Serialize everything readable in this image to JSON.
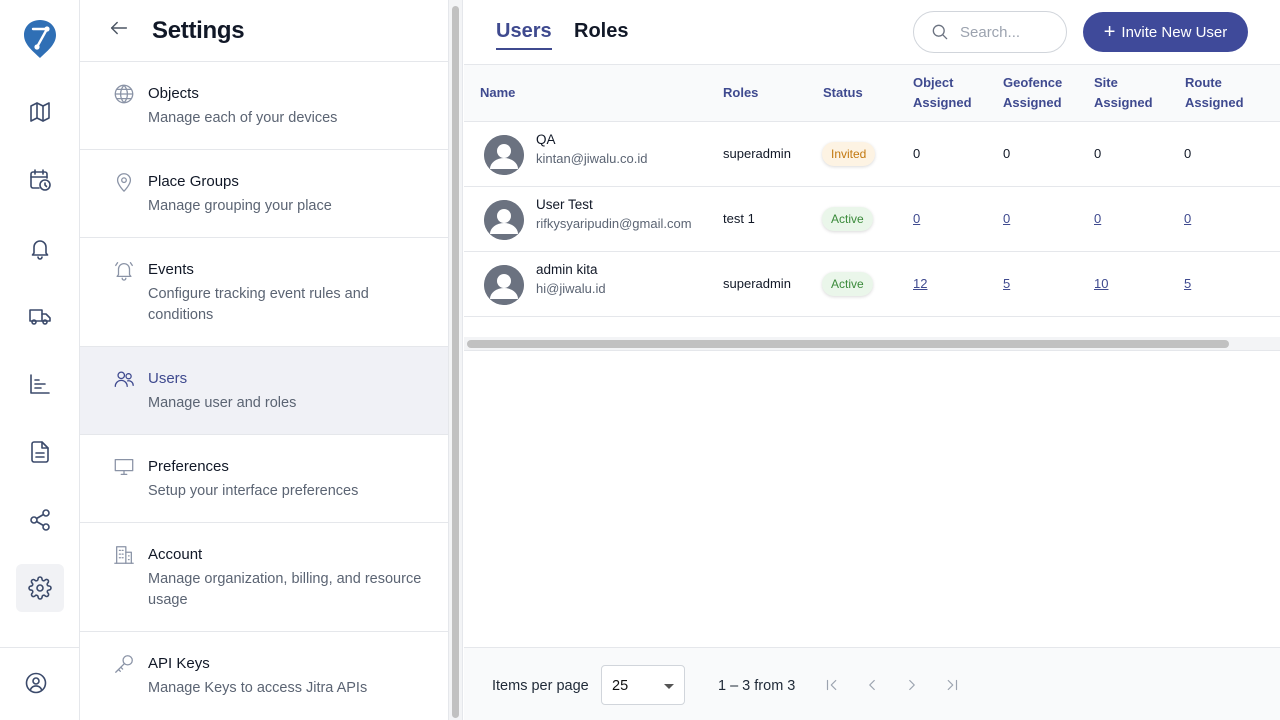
{
  "app": {
    "brand_colors": {
      "primary": "#3f4a9a",
      "logo_blue": "#2f6fb5"
    }
  },
  "rail": {
    "icons": [
      "map-icon",
      "calendar-clock-icon",
      "bell-icon",
      "truck-icon",
      "bar-chart-icon",
      "document-icon",
      "share-icon",
      "gear-icon",
      "user-circle-icon"
    ],
    "active": "gear-icon"
  },
  "settings": {
    "title": "Settings",
    "items": [
      {
        "label": "Objects",
        "desc": "Manage each of your devices",
        "icon": "globe-icon"
      },
      {
        "label": "Place Groups",
        "desc": "Manage grouping your place",
        "icon": "map-pin-icon"
      },
      {
        "label": "Events",
        "desc": "Configure tracking event rules and conditions",
        "icon": "bell-icon"
      },
      {
        "label": "Users",
        "desc": "Manage user and roles",
        "icon": "users-icon",
        "active": true
      },
      {
        "label": "Preferences",
        "desc": "Setup your interface preferences",
        "icon": "monitor-icon"
      },
      {
        "label": "Account",
        "desc": "Manage organization, billing, and resource usage",
        "icon": "building-icon"
      },
      {
        "label": "API Keys",
        "desc": "Manage Keys to access Jitra APIs",
        "icon": "key-icon"
      }
    ]
  },
  "main": {
    "tabs": [
      {
        "label": "Users",
        "active": true
      },
      {
        "label": "Roles",
        "active": false
      }
    ],
    "search": {
      "placeholder": "Search..."
    },
    "invite_button": "Invite New User",
    "table": {
      "headers": {
        "name": "Name",
        "roles": "Roles",
        "status": "Status",
        "object_l1": "Object",
        "object_l2": "Assigned",
        "geofence_l1": "Geofence",
        "geofence_l2": "Assigned",
        "site_l1": "Site",
        "site_l2": "Assigned",
        "route_l1": "Route",
        "route_l2": "Assigned"
      },
      "rows": [
        {
          "name": "QA",
          "email": "kintan@jiwalu.co.id",
          "role": "superadmin",
          "status": "Invited",
          "object": "0",
          "geofence": "0",
          "site": "0",
          "route": "0"
        },
        {
          "name": "User Test",
          "email": "rifkysyaripudin@gmail.com",
          "role": "test 1",
          "status": "Active",
          "object": "0",
          "geofence": "0",
          "site": "0",
          "route": "0"
        },
        {
          "name": "admin kita",
          "email": "hi@jiwalu.id",
          "role": "superadmin",
          "status": "Active",
          "object": "12",
          "geofence": "5",
          "site": "10",
          "route": "5"
        }
      ]
    },
    "paginator": {
      "items_per_page_label": "Items per page",
      "items_per_page_value": "25",
      "range": "1 – 3 from 3"
    }
  }
}
